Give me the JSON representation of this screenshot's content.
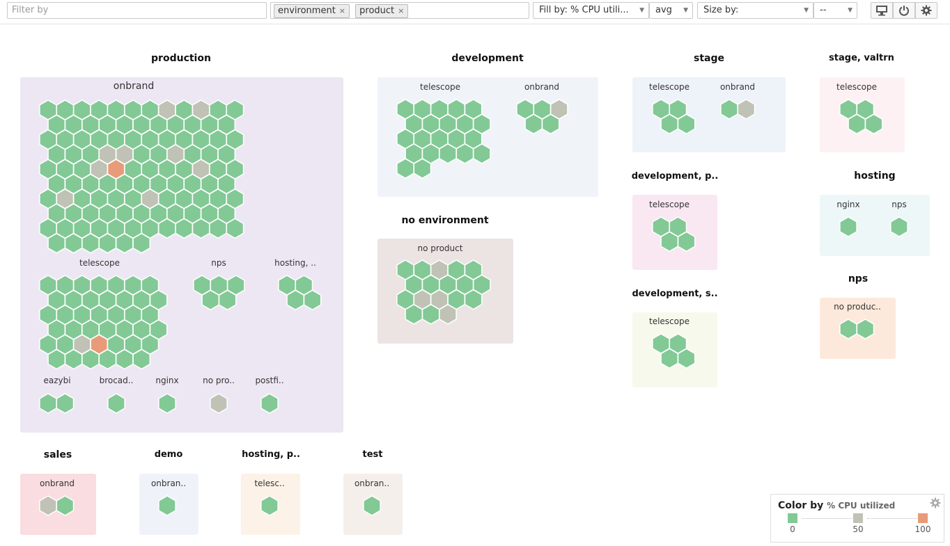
{
  "toolbar": {
    "filter_placeholder": "Filter by",
    "tags": [
      "environment",
      "product"
    ],
    "tag_remove": "×",
    "fill_by": "Fill by: % CPU utili...",
    "fill_agg": "avg",
    "size_by": "Size by:",
    "size_agg": "--",
    "icons": [
      "monitor-icon",
      "power-icon",
      "gear-icon"
    ]
  },
  "colors": {
    "green": "#82c995",
    "mid": "#bfc2b4",
    "high": "#e89b78",
    "hex_stroke": "#ffffff"
  },
  "groups": {
    "production": {
      "title": "production",
      "bg": "#ede7f4",
      "subs": {
        "onbrand": "onbrand",
        "telescope": "telescope",
        "nps": "nps",
        "hosting": "hosting, ..",
        "eazybi": "eazybi",
        "brocad": "brocad..",
        "nginx": "nginx",
        "nopro": "no pro..",
        "postfi": "postfi.."
      }
    },
    "development": {
      "title": "development",
      "bg": "#f0f4f9",
      "subs": {
        "telescope": "telescope",
        "onbrand": "onbrand"
      }
    },
    "no_environment": {
      "title": "no environment",
      "bg": "#ece4e2",
      "subs": {
        "noproduct": "no product"
      }
    },
    "stage": {
      "title": "stage",
      "bg": "#eef2f9",
      "subs": {
        "telescope": "telescope",
        "onbrand": "onbrand"
      }
    },
    "stage_valtrn": {
      "title": "stage, valtrn",
      "bg": "#fdf1f4",
      "subs": {
        "telescope": "telescope"
      }
    },
    "development_p": {
      "title": "development, p..",
      "bg": "#f9e7f2",
      "subs": {
        "telescope": "telescope"
      }
    },
    "hosting": {
      "title": "hosting",
      "bg": "#eef7f8",
      "subs": {
        "nginx": "nginx",
        "nps": "nps"
      }
    },
    "development_s": {
      "title": "development, s..",
      "bg": "#f8f9ed",
      "subs": {
        "telescope": "telescope"
      }
    },
    "nps": {
      "title": "nps",
      "bg": "#fde9dc",
      "subs": {
        "noproduc": "no produc.."
      }
    },
    "sales": {
      "title": "sales",
      "bg": "#f9dde0",
      "subs": {
        "onbrand": "onbrand"
      }
    },
    "demo": {
      "title": "demo",
      "bg": "#eff3f9",
      "subs": {
        "onbran": "onbran.."
      }
    },
    "hosting_p": {
      "title": "hosting, p..",
      "bg": "#fdf2e7",
      "subs": {
        "telesc": "telesc.."
      }
    },
    "test": {
      "title": "test",
      "bg": "#f5efec",
      "subs": {
        "onbran": "onbran.."
      }
    }
  },
  "legend": {
    "title": "Color by",
    "metric": "% CPU utilized",
    "stops": [
      "0",
      "50",
      "100"
    ],
    "stop_colors": [
      "#82c995",
      "#bfc2b4",
      "#e89b78"
    ]
  }
}
